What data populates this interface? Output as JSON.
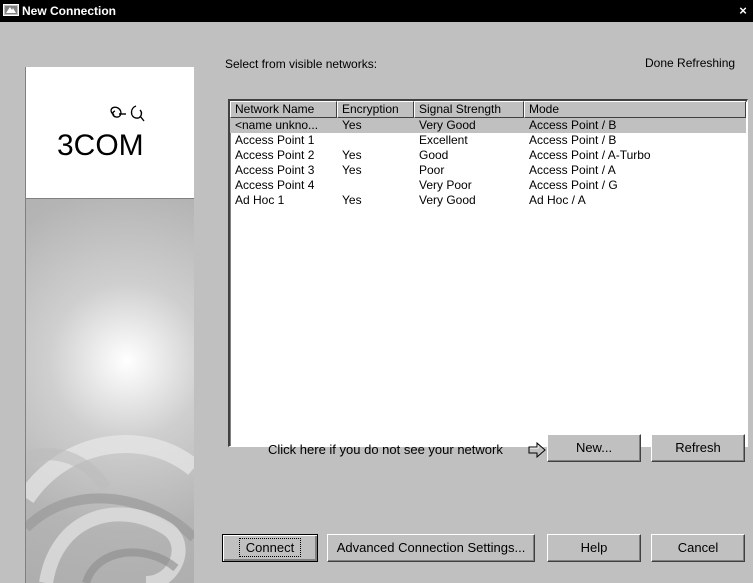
{
  "window": {
    "title": "New Connection",
    "close_glyph": "×"
  },
  "brand": {
    "logo_text": "3COM"
  },
  "network_section": {
    "label": "Select from visible networks:",
    "status": "Done Refreshing"
  },
  "table": {
    "columns": [
      "Network Name",
      "Encryption",
      "Signal Strength",
      "Mode"
    ],
    "rows": [
      {
        "name": "<name unkno...",
        "encryption": "Yes",
        "signal": "Very Good",
        "mode": "Access Point / B"
      },
      {
        "name": "Access Point 1",
        "encryption": "",
        "signal": "Excellent",
        "mode": "Access Point / B"
      },
      {
        "name": "Access Point 2",
        "encryption": "Yes",
        "signal": "Good",
        "mode": "Access Point / A-Turbo"
      },
      {
        "name": "Access Point 3",
        "encryption": "Yes",
        "signal": "Poor",
        "mode": "Access Point / A"
      },
      {
        "name": "Access Point 4",
        "encryption": "",
        "signal": "Very Poor",
        "mode": "Access Point / G"
      },
      {
        "name": "Ad Hoc 1",
        "encryption": "Yes",
        "signal": "Very Good",
        "mode": "Ad Hoc / A"
      }
    ],
    "selected_row": 0
  },
  "hint": {
    "text": "Click here if you do not see your network",
    "icon": "arrow-right-icon"
  },
  "buttons": {
    "new": "New...",
    "refresh": "Refresh",
    "connect": "Connect",
    "advanced": "Advanced Connection Settings...",
    "help": "Help",
    "cancel": "Cancel"
  },
  "colors": {
    "title_bar": "#000000",
    "face": "#c0c0c0",
    "selection": "#c0c0c0"
  }
}
